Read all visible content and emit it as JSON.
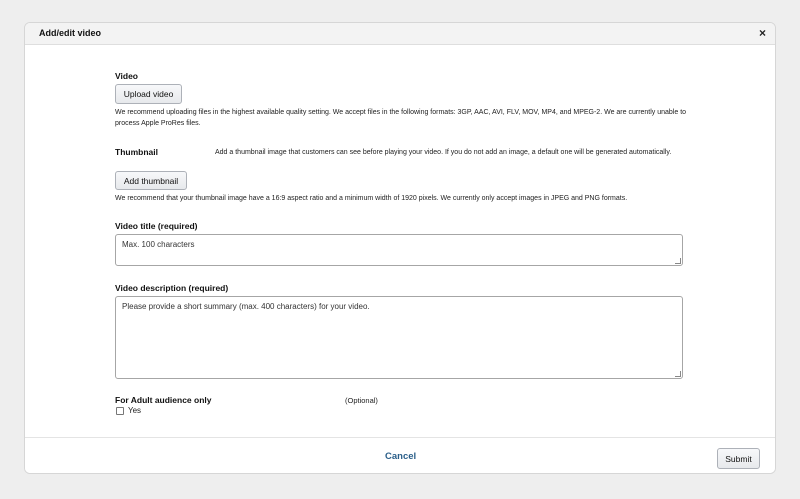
{
  "dialog": {
    "title": "Add/edit video",
    "close_glyph": "×"
  },
  "video": {
    "label": "Video",
    "upload_button": "Upload video",
    "help": "We recommend uploading files in the highest available quality setting. We accept files in the following formats: 3GP, AAC, AVI, FLV, MOV, MP4, and MPEG-2. We are currently unable to process Apple ProRes files."
  },
  "thumbnail": {
    "label": "Thumbnail",
    "description": "Add a thumbnail image that customers can see before playing your video. If you do not add an image, a default one will be generated automatically.",
    "add_button": "Add thumbnail",
    "help": "We recommend that your thumbnail image have a 16:9 aspect ratio and a minimum width of 1920 pixels. We currently only accept images in JPEG and PNG formats."
  },
  "title_field": {
    "label": "Video title (required)",
    "placeholder": "Max. 100 characters",
    "value": ""
  },
  "description_field": {
    "label": "Video description (required)",
    "placeholder": "Please provide a short summary (max. 400 characters) for your video.",
    "value": ""
  },
  "adult": {
    "label": "For Adult audience only",
    "optional_note": "(Optional)",
    "checkbox_label": "Yes",
    "checked": false
  },
  "footer": {
    "cancel_label": "Cancel",
    "submit_label": "Submit"
  },
  "colors": {
    "link": "#2b5f8a",
    "header_bg": "#f3f3f3",
    "page_bg": "#eeeeee"
  }
}
